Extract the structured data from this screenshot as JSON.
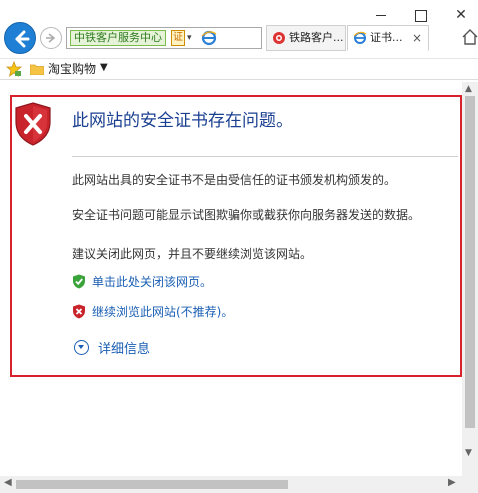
{
  "window": {
    "minimize": "—",
    "maximize": "☐",
    "close": "✕"
  },
  "nav": {
    "address_site": "中铁客户服务中心",
    "cert_badge": "证",
    "address_dropdown": "▾"
  },
  "tabs": [
    {
      "label": "铁路客户...",
      "icon": "site-icon"
    },
    {
      "label": "证书...",
      "icon": "ie-icon",
      "close": "×"
    }
  ],
  "favorites": {
    "folder_label": "淘宝购物",
    "caret": "▼"
  },
  "error": {
    "title": "此网站的安全证书存在问题。",
    "paragraph_1": "此网站出具的安全证书不是由受信任的证书颁发机构颁发的。",
    "paragraph_2": "安全证书问题可能显示试图欺骗你或截获你向服务器发送的数据。",
    "paragraph_3": "建议关闭此网页，并且不要继续浏览该网站。",
    "close_link": "单击此处关闭该网页。",
    "continue_link": "继续浏览此网站(不推荐)。",
    "details_link": "详细信息"
  },
  "scroll": {
    "up": "▲",
    "down": "▼",
    "left": "◀",
    "right": "▶"
  },
  "colors": {
    "back_button": "#1e7fd4",
    "highlight_border": "#d8222b",
    "title_blue": "#1a3f91",
    "link_blue": "#1a5fb4",
    "shield_red": "#c9242b",
    "safe_green": "#3aa33a"
  }
}
